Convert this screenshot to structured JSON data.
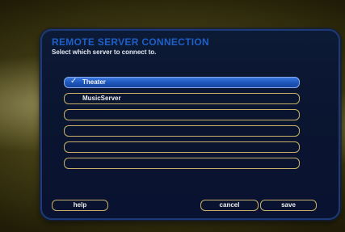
{
  "dialog": {
    "title": "REMOTE SERVER CONNECTION",
    "subtitle": "Select which server to connect to."
  },
  "servers": [
    {
      "label": "Theater",
      "selected": true
    },
    {
      "label": "MusicServer",
      "selected": false
    },
    {
      "label": "",
      "selected": false
    },
    {
      "label": "",
      "selected": false
    },
    {
      "label": "",
      "selected": false
    },
    {
      "label": "",
      "selected": false
    }
  ],
  "buttons": {
    "help": "help",
    "cancel": "cancel",
    "save": "save"
  },
  "colors": {
    "title": "#1e5fc8",
    "selected_row": "#2a62c8",
    "row_border": "#c8b06a",
    "panel_bg": "#0b1630"
  },
  "icons": {
    "selected_marker": "checkmark-icon"
  }
}
